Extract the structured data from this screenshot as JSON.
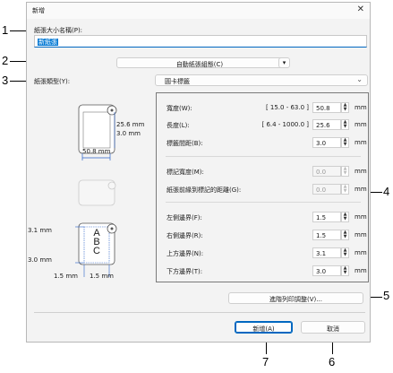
{
  "dialog": {
    "title": "新增",
    "close_glyph": "✕"
  },
  "paper_name": {
    "label": "紙張大小名稱(P):",
    "value": "新紙張"
  },
  "auto_format_button": "自動紙張組態(C)",
  "paper_type": {
    "label": "紙張類型(Y):",
    "value": "圓卡標籤"
  },
  "fields": [
    {
      "label": "寬度(W):",
      "range": "[ 15.0 - 63.0 ]",
      "value": "50.8",
      "unit": "mm",
      "enabled": true
    },
    {
      "label": "長度(L):",
      "range": "[ 6.4 - 1000.0 ]",
      "value": "25.6",
      "unit": "mm",
      "enabled": true
    },
    {
      "label": "標籤間距(B):",
      "range": "",
      "value": "3.0",
      "unit": "mm",
      "enabled": true
    },
    {
      "label": "標記寬度(M):",
      "range": "",
      "value": "0.0",
      "unit": "mm",
      "enabled": false
    },
    {
      "label": "紙張前緣到標記的距離(G):",
      "range": "",
      "value": "0.0",
      "unit": "mm",
      "enabled": false
    },
    {
      "label": "左側邊界(F):",
      "range": "",
      "value": "1.5",
      "unit": "mm",
      "enabled": true
    },
    {
      "label": "右側邊界(R):",
      "range": "",
      "value": "1.5",
      "unit": "mm",
      "enabled": true
    },
    {
      "label": "上方邊界(N):",
      "range": "",
      "value": "3.1",
      "unit": "mm",
      "enabled": true
    },
    {
      "label": "下方邊界(T):",
      "range": "",
      "value": "3.0",
      "unit": "mm",
      "enabled": true
    }
  ],
  "diagram": {
    "roll_height": "25.6 mm",
    "roll_gap": "3.0 mm",
    "roll_width": "50.8 mm",
    "top_margin": "3.1 mm",
    "bottom_margin": "3.0 mm",
    "left_margin": "1.5 mm",
    "right_margin": "1.5 mm",
    "label_text": "A\nB\nC"
  },
  "advanced_button": "進階列印調整(V)...",
  "add_button": "新增(A)",
  "cancel_button": "取消",
  "callouts": [
    "1",
    "2",
    "3",
    "4",
    "5",
    "6",
    "7"
  ],
  "spin_up": "▲",
  "spin_down": "▼",
  "combo_arrow": "▾",
  "chevron": "⌄"
}
